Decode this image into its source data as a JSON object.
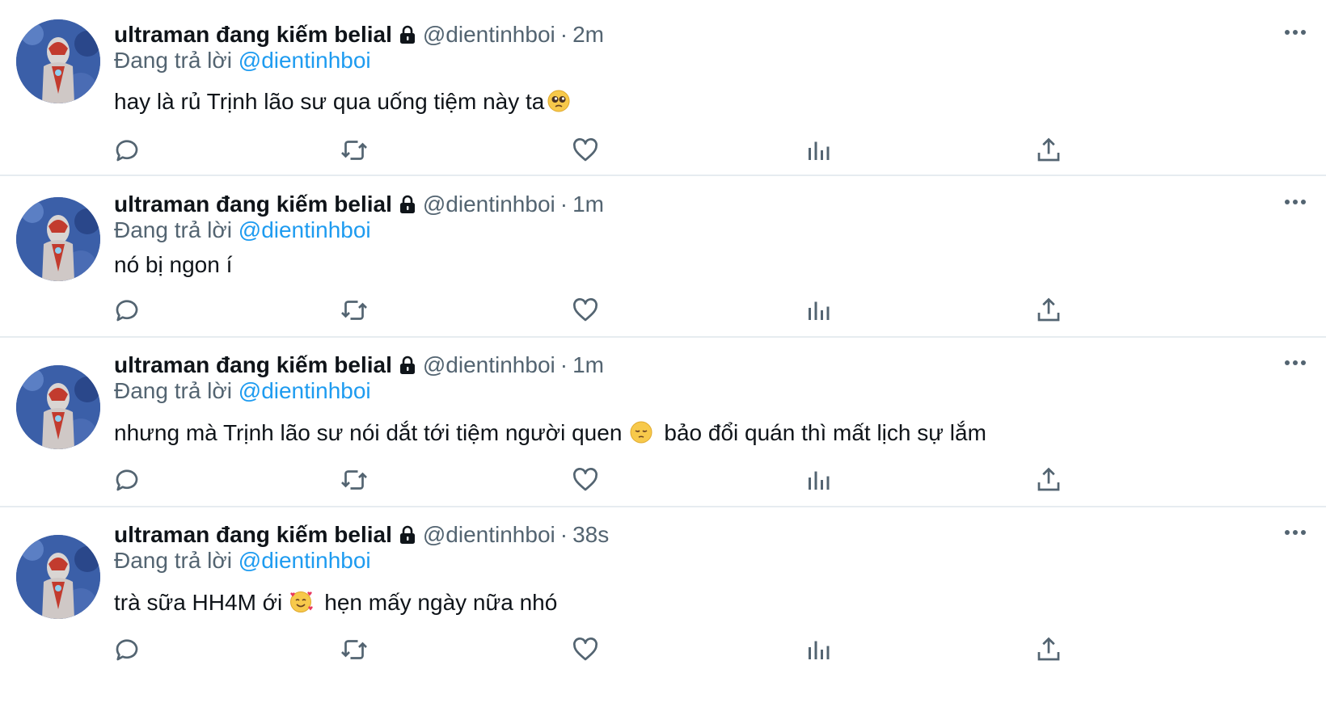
{
  "tweets": [
    {
      "name": "ultraman đang kiếm belial",
      "handle": "@dientinhboi",
      "dot": "·",
      "time": "2m",
      "reply_prefix": "Đang trả lời",
      "reply_to": "@dientinhboi",
      "text_before": "hay là rủ Trịnh lão sư qua uống tiệm này ta",
      "emoji_icon": "pleading-face-icon",
      "text_after": ""
    },
    {
      "name": "ultraman đang kiếm belial",
      "handle": "@dientinhboi",
      "dot": "·",
      "time": "1m",
      "reply_prefix": "Đang trả lời",
      "reply_to": "@dientinhboi",
      "text_before": "nó bị ngon í",
      "emoji_icon": "",
      "text_after": ""
    },
    {
      "name": "ultraman đang kiếm belial",
      "handle": "@dientinhboi",
      "dot": "·",
      "time": "1m",
      "reply_prefix": "Đang trả lời",
      "reply_to": "@dientinhboi",
      "text_before": "nhưng mà Trịnh lão sư nói dắt tới tiệm người quen",
      "emoji_icon": "pensive-face-icon",
      "text_after": "bảo đổi quán thì mất lịch sự lắm"
    },
    {
      "name": "ultraman đang kiếm belial",
      "handle": "@dientinhboi",
      "dot": "·",
      "time": "38s",
      "reply_prefix": "Đang trả lời",
      "reply_to": "@dientinhboi",
      "text_before": "trà sữa HH4M ới",
      "emoji_icon": "smiling-face-with-hearts-icon",
      "text_after": "hẹn mấy ngày nữa nhó"
    }
  ],
  "action_icons": [
    "reply-icon",
    "retweet-icon",
    "like-icon",
    "analytics-icon",
    "share-icon"
  ],
  "colors": {
    "text": "#0f1419",
    "secondary": "#536471",
    "link": "#1d9bf0",
    "divider": "#e6ecf0"
  }
}
